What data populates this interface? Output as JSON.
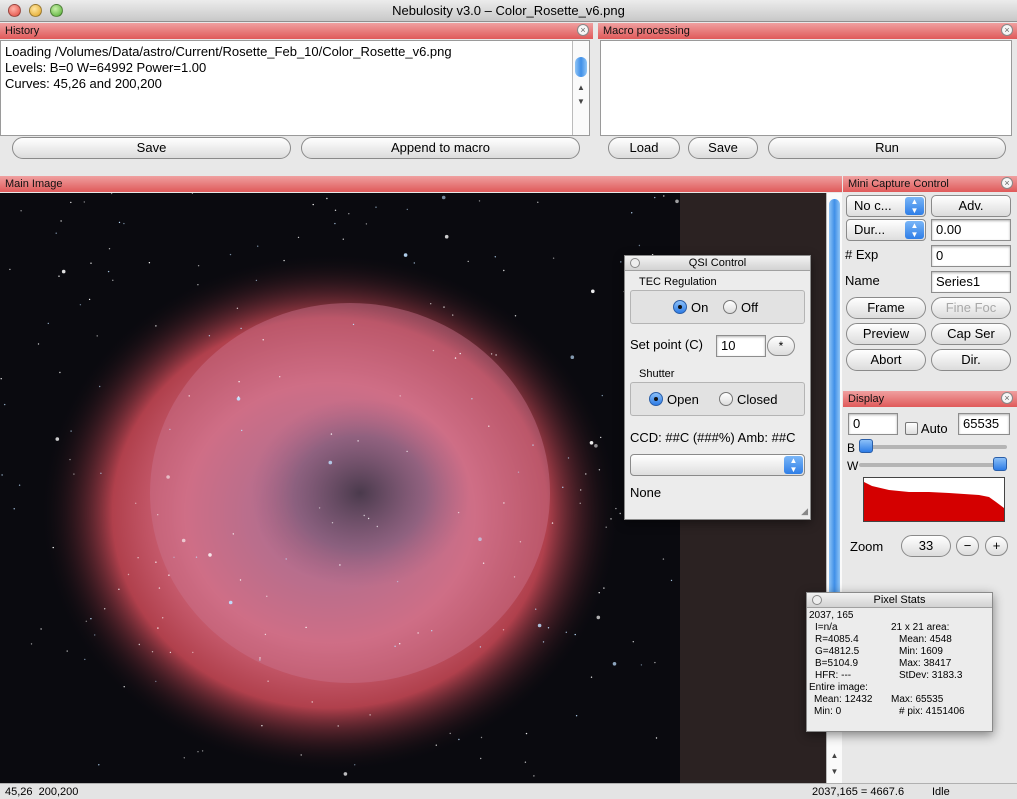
{
  "window": {
    "title": "Nebulosity v3.0 – Color_Rosette_v6.png"
  },
  "history": {
    "title": "History",
    "lines": [
      "Loading /Volumes/Data/astro/Current/Rosette_Feb_10/Color_Rosette_v6.png",
      "Levels: B=0 W=64992 Power=1.00",
      "Curves: 45,26 and 200,200"
    ],
    "save_label": "Save",
    "append_label": "Append to macro"
  },
  "macro": {
    "title": "Macro processing",
    "load_label": "Load",
    "save_label": "Save",
    "run_label": "Run"
  },
  "main_image": {
    "title": "Main Image"
  },
  "mini_capture": {
    "title": "Mini Capture Control",
    "camera_select": "No c...",
    "adv_label": "Adv.",
    "duration_select": "Dur...",
    "duration_value": "0.00",
    "exp_label": "# Exp",
    "exp_value": "0",
    "name_label": "Name",
    "name_value": "Series1",
    "frame_label": "Frame",
    "finefoc_label": "Fine Foc",
    "preview_label": "Preview",
    "capser_label": "Cap Ser",
    "abort_label": "Abort",
    "dir_label": "Dir."
  },
  "display": {
    "title": "Display",
    "black_value": "0",
    "auto_label": "Auto",
    "white_value": "65535",
    "b_label": "B",
    "w_label": "W",
    "zoom_label": "Zoom",
    "zoom_value": "33",
    "zoom_minus": "−",
    "zoom_plus": "+",
    "b_slider_fraction": 0.0,
    "w_slider_fraction": 1.0,
    "histogram_color": "#d40000"
  },
  "qsi": {
    "title": "QSI Control",
    "tec_label": "TEC Regulation",
    "tec_on": "On",
    "tec_off": "Off",
    "setpoint_label": "Set point (C)",
    "setpoint_value": "10",
    "star_label": "*",
    "shutter_label": "Shutter",
    "shutter_open": "Open",
    "shutter_closed": "Closed",
    "ccd_text": "CCD: ##C (###%) Amb: ##C",
    "filter_value": "",
    "status_text": "None"
  },
  "pixel_stats": {
    "title": "Pixel Stats",
    "coords": "2037, 165",
    "i": "I=n/a",
    "r": "R=4085.4",
    "g": "G=4812.5",
    "b": "B=5104.9",
    "hfr": "HFR: ---",
    "area_label": "21 x 21 area:",
    "area_mean": "Mean: 4548",
    "area_min": "Min: 1609",
    "area_max": "Max: 38417",
    "area_stdev": "StDev: 3183.3",
    "entire_label": "Entire image:",
    "entire_mean": "Mean: 12432",
    "entire_min": "Min: 0",
    "entire_max": "Max: 65535",
    "entire_npix": "# pix: 4151406"
  },
  "status_bar": {
    "left": "45,26  200,200",
    "right": "2037,165 = 4667.6",
    "state": "Idle"
  }
}
